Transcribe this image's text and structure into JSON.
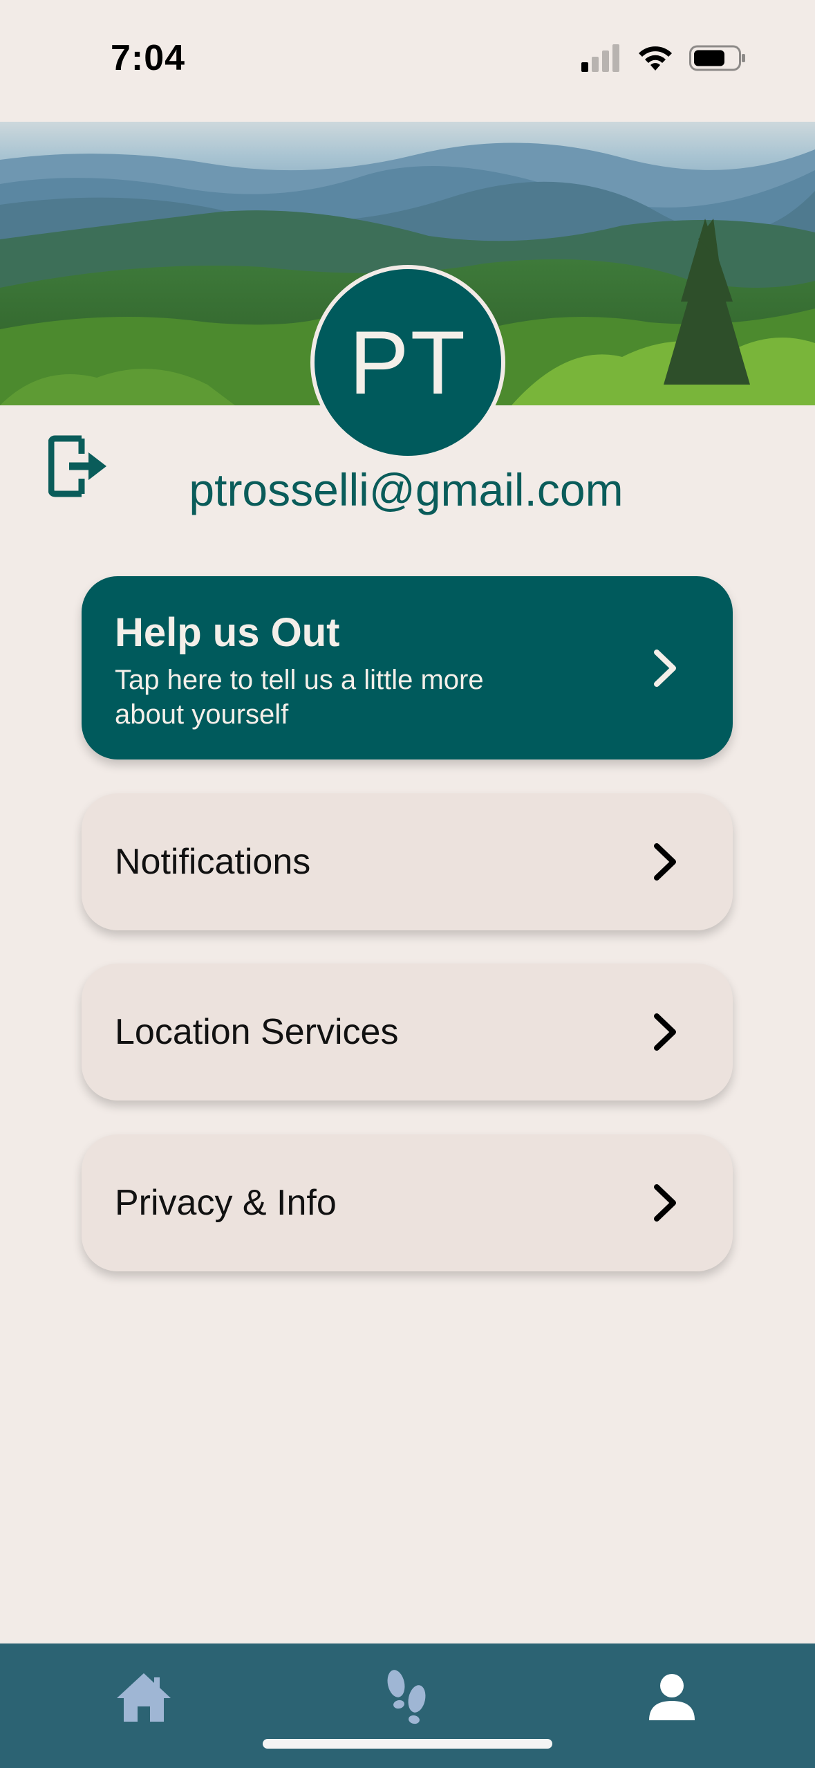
{
  "status_bar": {
    "time": "7:04"
  },
  "profile": {
    "initials": "PT",
    "email": "ptrosselli@gmail.com"
  },
  "help_card": {
    "title": "Help us Out",
    "subtitle": "Tap here to tell us a little more about yourself"
  },
  "menu": [
    {
      "label": "Notifications"
    },
    {
      "label": "Location Services"
    },
    {
      "label": "Privacy & Info"
    }
  ],
  "tab_bar": {
    "items": [
      {
        "icon": "home-icon"
      },
      {
        "icon": "footsteps-icon"
      },
      {
        "icon": "person-icon",
        "active": true
      }
    ]
  },
  "colors": {
    "background": "#f2ebe7",
    "accent": "#005a5c",
    "card": "#ece2dd",
    "tab_bar": "#2c6373",
    "inactive_icon": "#9fb6d4"
  }
}
